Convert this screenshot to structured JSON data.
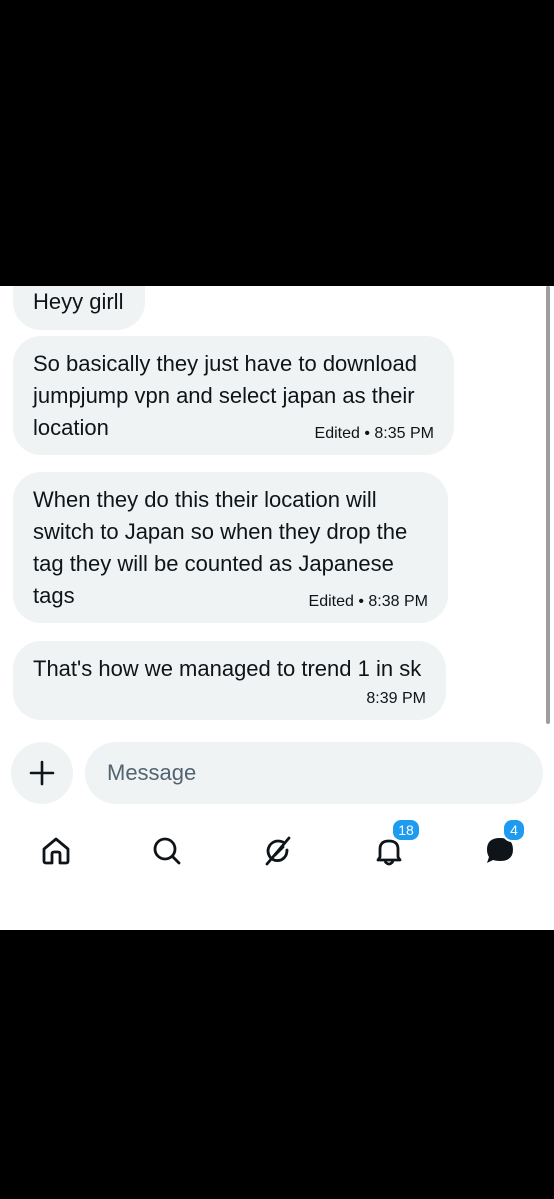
{
  "messages": [
    {
      "text": "Heyy girll",
      "meta": ""
    },
    {
      "text": "So basically they just have to download jumpjump vpn and select japan as their location",
      "meta": "Edited • 8:35 PM"
    },
    {
      "text": "When they do this their location will switch to Japan  so when they drop the tag  they will be counted as Japanese tags",
      "meta": "Edited • 8:38 PM"
    },
    {
      "text": "That's how we managed to trend 1 in sk",
      "meta": "8:39 PM"
    }
  ],
  "composer": {
    "placeholder": "Message",
    "add_icon": "plus-icon"
  },
  "nav": {
    "items": [
      {
        "icon": "home-icon"
      },
      {
        "icon": "search-icon"
      },
      {
        "icon": "grok-icon"
      },
      {
        "icon": "bell-icon",
        "badge": "18"
      },
      {
        "icon": "messages-icon",
        "badge": "4"
      }
    ]
  },
  "colors": {
    "bubble": "#eff3f4",
    "text": "#0f1419",
    "badge": "#1d9bf0"
  }
}
